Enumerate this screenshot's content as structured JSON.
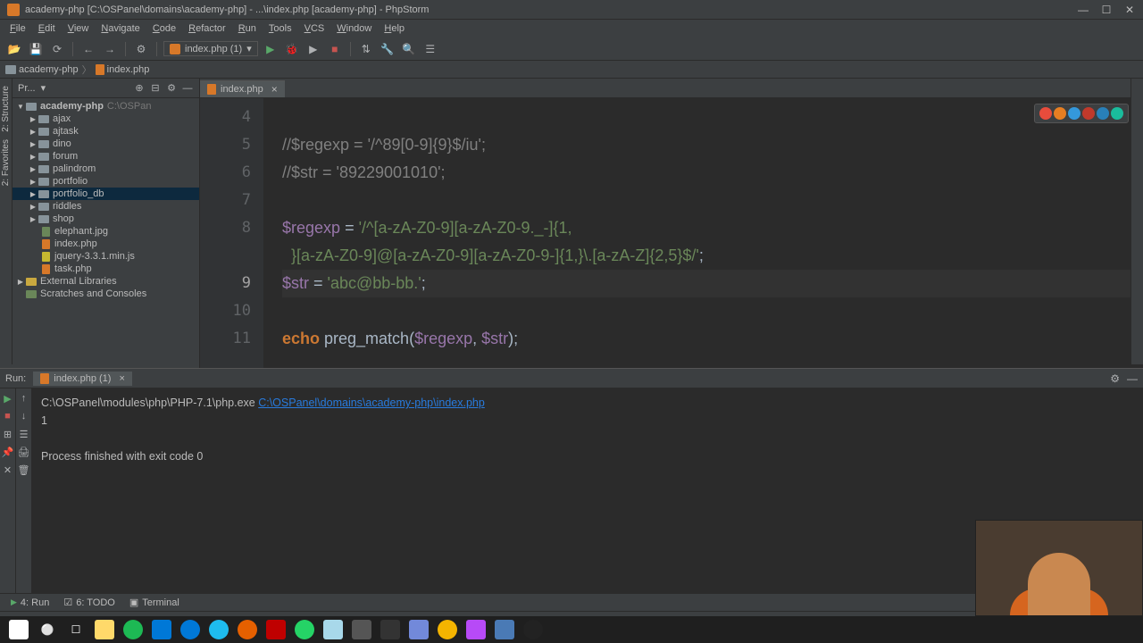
{
  "window": {
    "title": "academy-php [C:\\OSPanel\\domains\\academy-php] - ...\\index.php [academy-php] - PhpStorm"
  },
  "menu": [
    "File",
    "Edit",
    "View",
    "Navigate",
    "Code",
    "Refactor",
    "Run",
    "Tools",
    "VCS",
    "Window",
    "Help"
  ],
  "toolbar": {
    "run_config": "index.php (1)"
  },
  "breadcrumbs": {
    "project": "academy-php",
    "file": "index.php"
  },
  "project_header": {
    "label": "Pr..."
  },
  "tree": {
    "root": "academy-php",
    "root_path": "C:\\OSPan",
    "folders": [
      "ajax",
      "ajtask",
      "dino",
      "forum",
      "palindrom",
      "portfolio",
      "portfolio_db",
      "riddles",
      "shop"
    ],
    "files": [
      {
        "name": "elephant.jpg",
        "type": "img"
      },
      {
        "name": "index.php",
        "type": "php"
      },
      {
        "name": "jquery-3.3.1.min.js",
        "type": "js"
      },
      {
        "name": "task.php",
        "type": "php"
      }
    ],
    "selected": "portfolio_db",
    "external": "External Libraries",
    "scratches": "Scratches and Consoles"
  },
  "editor": {
    "tab": "index.php",
    "lines": {
      "4": "",
      "5": {
        "comment": "//$regexp = '/^89[0-9]{9}$/iu';"
      },
      "6": {
        "comment": "//$str = '89229001010';"
      },
      "7": "",
      "8a": {
        "var": "$regexp",
        "op": " = ",
        "str": "'/^[a-zA-Z0-9][a-zA-Z0-9._-]{1,"
      },
      "8b": {
        "str": "  }[a-zA-Z0-9]@[a-zA-Z0-9][a-zA-Z0-9-]{1,}\\.[a-zA-Z]{2,5}$/'",
        "op": ";"
      },
      "9": {
        "var": "$str",
        "op": " = ",
        "str": "'abc@bb-bb.'",
        "op2": ";"
      },
      "10": "",
      "11": {
        "key": "echo ",
        "func": "preg_match",
        "op": "(",
        "var1": "$regexp",
        "op2": ", ",
        "var2": "$str",
        "op3": ");"
      }
    }
  },
  "run": {
    "label": "Run:",
    "tab": "index.php (1)",
    "exe": "C:\\OSPanel\\modules\\php\\PHP-7.1\\php.exe ",
    "link": "C:\\OSPanel\\domains\\academy-php\\index.php",
    "output": "1",
    "exit": "Process finished with exit code 0"
  },
  "status": {
    "run": "4: Run",
    "todo": "6: TODO",
    "terminal": "Terminal"
  },
  "left_tools": [
    "2: Structure",
    "2: Favorites"
  ]
}
